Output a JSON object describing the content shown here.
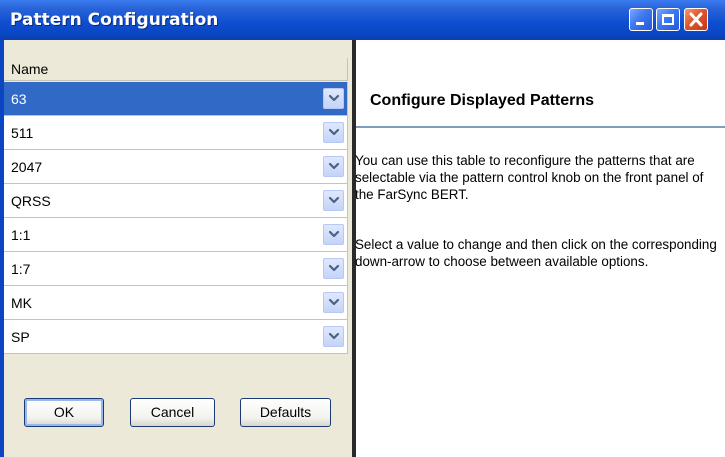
{
  "window": {
    "title": "Pattern Configuration",
    "controls": {
      "minimize_icon": "minimize-icon",
      "maximize_icon": "maximize-icon",
      "close_icon": "close-icon"
    }
  },
  "table": {
    "header": "Name",
    "rows": [
      {
        "value": "63",
        "selected": true
      },
      {
        "value": "511"
      },
      {
        "value": "2047"
      },
      {
        "value": "QRSS"
      },
      {
        "value": "1:1"
      },
      {
        "value": "1:7"
      },
      {
        "value": "MK"
      },
      {
        "value": "SP"
      }
    ],
    "dropdown_icon": "chevron-down-icon"
  },
  "buttons": {
    "ok": "OK",
    "cancel": "Cancel",
    "defaults": "Defaults"
  },
  "help": {
    "title": "Configure Displayed Patterns",
    "paragraph1": "You can use this table to reconfigure the patterns that are selectable via the pattern control knob on the front panel of the FarSync BERT.",
    "paragraph2": "Select a value to change and then click on the corresponding down-arrow to choose between available options."
  },
  "colors": {
    "titlebar": "#0a46c4",
    "selected_row": "#3169c6",
    "panel": "#ece9d8",
    "close_button": "#e0552d"
  }
}
